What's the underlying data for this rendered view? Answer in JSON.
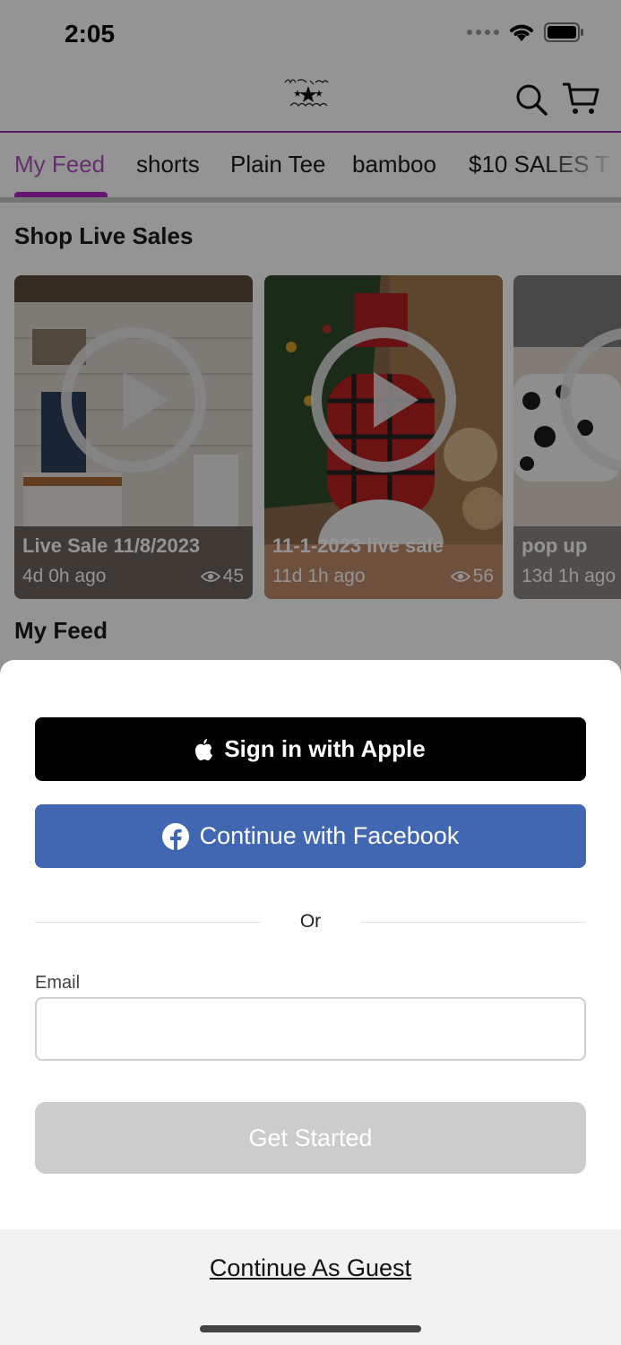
{
  "status_bar": {
    "time": "2:05"
  },
  "header": {
    "logo_icon": "north-star-boutique-logo",
    "search_icon": "search-icon",
    "cart_icon": "cart-icon"
  },
  "tabs": [
    {
      "label": "My Feed",
      "active": true
    },
    {
      "label": "shorts"
    },
    {
      "label": "Plain Tee"
    },
    {
      "label": "bamboo"
    },
    {
      "label": "$10 SALES T"
    }
  ],
  "live_sales": {
    "title": "Shop Live Sales",
    "cards": [
      {
        "title": "Live Sale 11/8/2023",
        "time": "4d 0h ago",
        "views": "45"
      },
      {
        "title": "11-1-2023 live sale",
        "time": "11d 1h ago",
        "views": "56"
      },
      {
        "title": "pop up",
        "time": "13d 1h ago",
        "views": ""
      }
    ]
  },
  "feed": {
    "title": "My Feed"
  },
  "sheet": {
    "apple_label": "Sign in with Apple",
    "facebook_label": "Continue with Facebook",
    "or_label": "Or",
    "email_label": "Email",
    "email_value": "",
    "email_placeholder": "",
    "get_started_label": "Get Started",
    "guest_label": "Continue As Guest"
  },
  "colors": {
    "accent": "#b024c4",
    "facebook": "#4267b2",
    "apple": "#000000",
    "disabled_button": "#cccccc"
  }
}
